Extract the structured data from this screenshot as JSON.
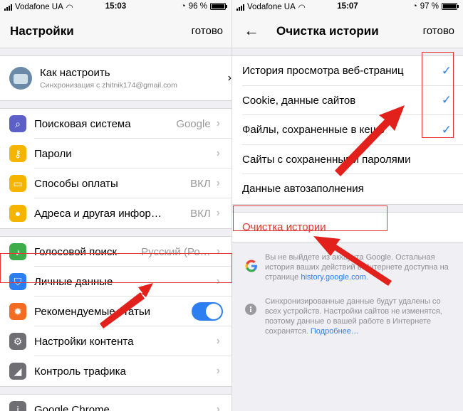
{
  "left": {
    "status": {
      "carrier": "Vodafone UA",
      "time": "15:03",
      "battery": "96 %"
    },
    "nav": {
      "title": "Настройки",
      "done": "готово"
    },
    "account": {
      "title": "Как настроить",
      "subtitle": "Синхронизация с zhitnik174@gmail.com"
    },
    "group1": [
      {
        "label": "Поисковая система",
        "value": "Google",
        "icon": "search-icon",
        "color": "#5b5fc7"
      },
      {
        "label": "Пароли",
        "value": "",
        "icon": "key-icon",
        "color": "#f5b400"
      },
      {
        "label": "Способы оплаты",
        "value": "ВКЛ",
        "icon": "card-icon",
        "color": "#f5b400"
      },
      {
        "label": "Адреса и другая инфор…",
        "value": "ВКЛ",
        "icon": "person-icon",
        "color": "#f5b400"
      }
    ],
    "group2": [
      {
        "label": "Голосовой поиск",
        "value": "Русский (Ро…",
        "icon": "mic-icon",
        "color": "#3dac4a"
      },
      {
        "label": "Личные данные",
        "value": "",
        "icon": "shield-icon",
        "color": "#2d7ff1"
      },
      {
        "label": "Рекомендуемые статьи",
        "value": "",
        "icon": "fire-icon",
        "color": "#f36c21",
        "toggle": true
      },
      {
        "label": "Настройки контента",
        "value": "",
        "icon": "gear-icon",
        "color": "#6e6e73"
      },
      {
        "label": "Контроль трафика",
        "value": "",
        "icon": "signal-icon",
        "color": "#6e6e73"
      }
    ],
    "group3": [
      {
        "label": "Google Chrome",
        "value": "",
        "icon": "info-icon",
        "color": "#6e6e73"
      }
    ]
  },
  "right": {
    "status": {
      "carrier": "Vodafone UA",
      "time": "15:07",
      "battery": "97 %"
    },
    "nav": {
      "title": "Очистка истории",
      "done": "готово"
    },
    "items": [
      {
        "label": "История просмотра веб-страниц",
        "checked": true
      },
      {
        "label": "Cookie, данные сайтов",
        "checked": true
      },
      {
        "label": "Файлы, сохраненные в кеше",
        "checked": true
      },
      {
        "label": "Сайты с сохраненными паролями",
        "checked": false
      },
      {
        "label": "Данные автозаполнения",
        "checked": false
      }
    ],
    "clear_label": "Очистка истории",
    "note1": {
      "text": "Вы не выйдете из аккаунта Google. Остальная история ваших действий в Интернете доступна на странице ",
      "link": "history.google.com",
      "tail": "."
    },
    "note2": {
      "text": "Синхронизированные данные будут удалены со всех устройств. Настройки сайтов не изменятся, поэтому данные о вашей работе в Интернете сохранятся. ",
      "link": "Подробнее…"
    },
    "check_glyph": "✓"
  }
}
